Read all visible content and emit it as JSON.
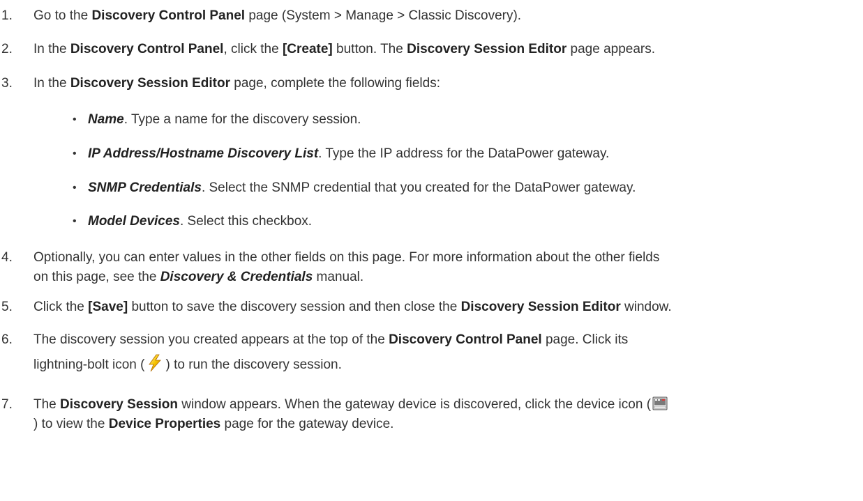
{
  "steps": [
    {
      "num": "1.",
      "parts": [
        "Go to the ",
        "Discovery Control Panel",
        " page (System > Manage > Classic Discovery)."
      ]
    },
    {
      "num": "2.",
      "parts": [
        "In the ",
        "Discovery Control Panel",
        ", click the ",
        "[Create]",
        " button. The ",
        "Discovery Session Editor",
        " page appears."
      ]
    },
    {
      "num": "3.",
      "parts": [
        "In the ",
        "Discovery Session Editor",
        " page, complete the following fields:"
      ]
    },
    {
      "num": "4.",
      "line1": "Optionally, you can enter values in the other fields on this page. For more information about the other fields",
      "line2_pre": "on this page, see the ",
      "line2_em": "Discovery & Credentials",
      "line2_post": " manual."
    },
    {
      "num": "5.",
      "parts": [
        "Click the ",
        "[Save]",
        " button to save the discovery session and then close the ",
        "Discovery Session Editor",
        " window."
      ]
    },
    {
      "num": "6.",
      "line1_pre": "The discovery session you created appears at the top of the ",
      "line1_b": "Discovery Control Panel",
      "line1_post": " page. Click its",
      "line2_pre": "lightning-bolt icon (",
      "line2_post": ") to run the discovery session."
    },
    {
      "num": "7.",
      "line1_pre": "The ",
      "line1_b": "Discovery Session",
      "line1_mid": " window appears. When the gateway device is discovered, click the device icon (",
      "line2_pre": ") to view the ",
      "line2_b": "Device Properties",
      "line2_post": " page for the gateway device."
    }
  ],
  "bullets": [
    {
      "label": "Name",
      "text": ". Type a name for the discovery session."
    },
    {
      "label": "IP Address/Hostname Discovery List",
      "text": ". Type the IP address for the DataPower gateway."
    },
    {
      "label": "SNMP Credentials",
      "text": ". Select the SNMP credential that you created for the DataPower gateway."
    },
    {
      "label": "Model Devices",
      "text": ". Select this checkbox."
    }
  ],
  "bullet_char": "•",
  "icons": {
    "lightning": "lightning-bolt-icon",
    "device": "device-icon"
  }
}
